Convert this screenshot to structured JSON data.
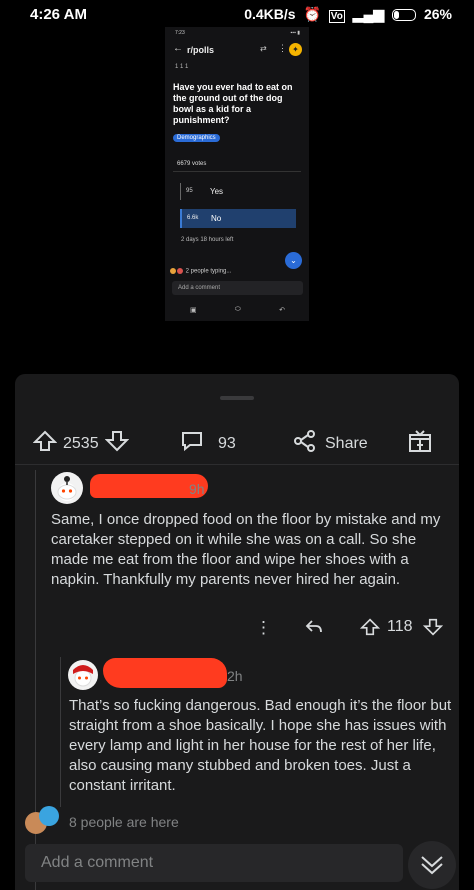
{
  "status_bar": {
    "time": "4:26 AM",
    "net_speed": "0.4KB/s",
    "battery": "26%"
  },
  "embedded_screenshot": {
    "subreddit": "r/polls",
    "award_counts": "1   1   1",
    "post_title": "Have you ever had to eat on the ground out of the dog bowl as a kid for a punishment?",
    "flair": "Demographics",
    "total_votes": "6679 votes",
    "options": [
      {
        "count": "95",
        "label": "Yes"
      },
      {
        "count": "6.6k",
        "label": "No"
      }
    ],
    "time_remaining": "2 days 18 hours left",
    "typing": "2 people typing...",
    "add_comment": "Add a comment"
  },
  "post_actions": {
    "upvotes": "2535",
    "comments": "93",
    "share_label": "Share"
  },
  "comments": [
    {
      "time": "9h",
      "body": "Same, I once dropped food on the floor by mistake and my caretaker stepped on it while she was on a call. So she made me eat from the floor and wipe her shoes with a napkin. Thankfully my parents never hired her again.",
      "votes": "118"
    },
    {
      "time": "2h",
      "body": "That’s so fucking dangerous. Bad enough it’s the floor but straight from a shoe basically. I hope she has issues with every lamp and light in her house for the rest of her life, also causing many stubbed and broken toes. Just a constant irritant."
    }
  ],
  "presence": "8 people are here",
  "composer": {
    "placeholder": "Add a comment"
  },
  "colors": {
    "sheet_bg": "#1a1a1b",
    "accent_blue": "#2a6bd6",
    "redaction": "#ff3b1f"
  }
}
